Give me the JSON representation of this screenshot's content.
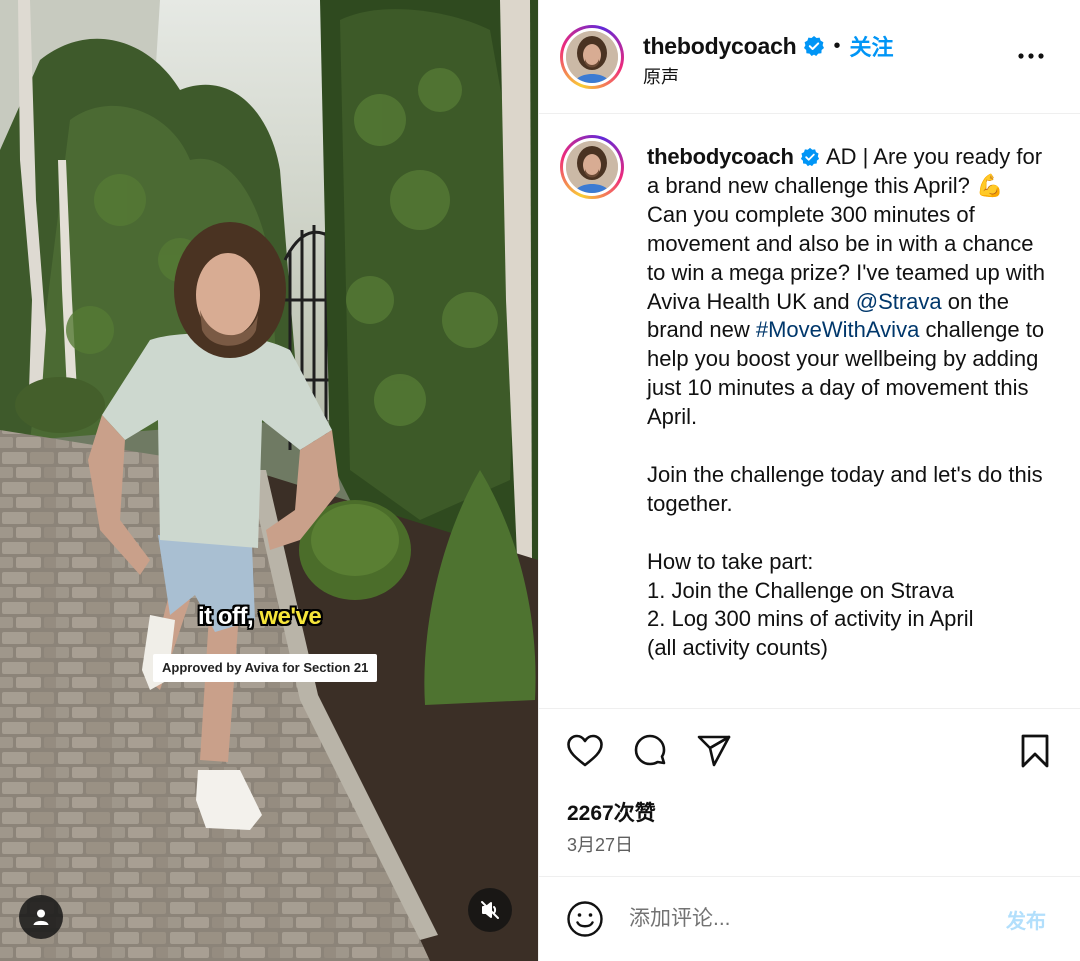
{
  "colors": {
    "accent_blue": "#0095f6",
    "link_dark_blue": "#00376b",
    "verified_blue": "#0095f6",
    "caption_highlight": "#f6e53a",
    "post_button_disabled": "#b2dffc"
  },
  "video": {
    "caption_part1": "it off,",
    "caption_part2": "we've",
    "approved_badge": "Approved by Aviva for Section 21",
    "user_tag_icon": "user-icon",
    "mute_icon": "speaker-muted-icon"
  },
  "header": {
    "username": "thebodycoach",
    "separator": "•",
    "follow_label": "关注",
    "audio_label": "原声",
    "more_icon": "more-horizontal-icon"
  },
  "caption": {
    "username": "thebodycoach",
    "text_intro": "AD | Are you ready for a brand new challenge this April? 💪 Can you complete 300 minutes of movement and also be in with a chance to win a mega prize? I've teamed up with Aviva Health UK and",
    "mention": "@Strava",
    "text_mid": "on the brand new",
    "hashtag": "#MoveWithAviva",
    "text_rest": "challenge to help you boost your wellbeing by adding just 10 minutes a day of movement this April.",
    "paragraph_2": "Join the challenge today and let's do this together.",
    "how_to_heading": "How to take part:",
    "steps": [
      "1. Join the Challenge on Strava",
      "2. Log 300 mins of activity in April",
      "(all activity counts)"
    ]
  },
  "actions": {
    "like_icon": "heart-icon",
    "comment_icon": "comment-icon",
    "share_icon": "paper-plane-icon",
    "save_icon": "bookmark-icon",
    "likes_text": "2267次赞",
    "date_text": "3月27日"
  },
  "comment_bar": {
    "emoji_icon": "emoji-icon",
    "placeholder": "添加评论...",
    "post_label": "发布"
  }
}
